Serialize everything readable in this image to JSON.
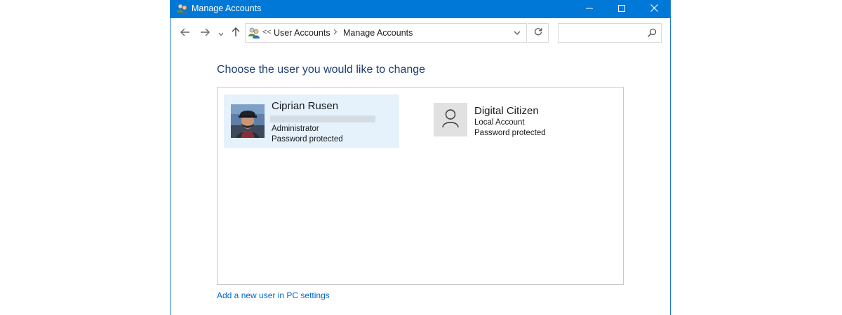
{
  "window": {
    "title": "Manage Accounts",
    "icons": {
      "app": "user-accounts-icon",
      "minimize": "minimize-icon",
      "maximize": "maximize-icon",
      "close": "close-icon"
    }
  },
  "navigation": {
    "breadcrumb_overflow": "<<",
    "breadcrumbs": [
      "User Accounts",
      "Manage Accounts"
    ],
    "icons": {
      "back": "arrow-left-icon",
      "forward": "arrow-right-icon",
      "recent": "chevron-down-icon",
      "up": "arrow-up-icon",
      "address": "user-accounts-icon",
      "dropdown": "chevron-down-icon",
      "refresh": "refresh-icon",
      "search": "search-icon"
    },
    "search": {
      "value": "",
      "placeholder": ""
    }
  },
  "main": {
    "heading": "Choose the user you would like to change",
    "accounts": [
      {
        "name": "Ciprian Rusen",
        "email": "",
        "type": "Administrator",
        "status": "Password protected",
        "selected": true,
        "avatar": "user-photo"
      },
      {
        "name": "Digital Citizen",
        "type": "Local Account",
        "status": "Password protected",
        "selected": false,
        "avatar": "generic-user-icon"
      }
    ],
    "add_user_link": "Add a new user in PC settings"
  },
  "colors": {
    "titlebar": "#0078d7",
    "heading": "#1e3f73",
    "link": "#0066cc",
    "selected_tile": "#e5f1fb"
  }
}
